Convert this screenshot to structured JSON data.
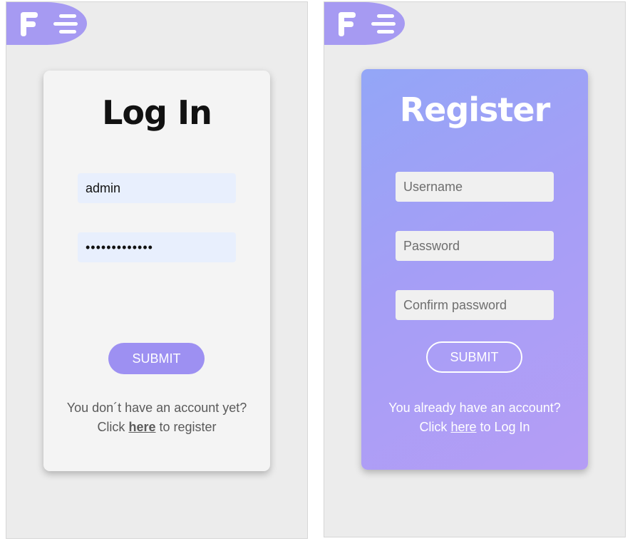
{
  "login": {
    "title": "Log In",
    "username_value": "admin",
    "password_value": "•••••••••••••",
    "submit_label": "SUBMIT",
    "footer_line1": "You don´t have an account yet?",
    "footer_prefix": "Click",
    "footer_link": "here",
    "footer_suffix": "to register"
  },
  "register": {
    "title": "Register",
    "username_placeholder": "Username",
    "password_placeholder": "Password",
    "confirm_placeholder": "Confirm password",
    "submit_label": "SUBMIT",
    "footer_line1": "You already have an account?",
    "footer_prefix": "Click",
    "footer_link": "here",
    "footer_suffix": "to Log In"
  },
  "icons": {
    "logo": "f-logo-icon",
    "menu": "hamburger-menu-icon"
  },
  "colors": {
    "brand_purple": "#a69af2",
    "login_button": "#9d90f2",
    "register_gradient_start": "#93a6f7",
    "register_gradient_end": "#b59df5",
    "login_field_bg": "#e8effd"
  }
}
